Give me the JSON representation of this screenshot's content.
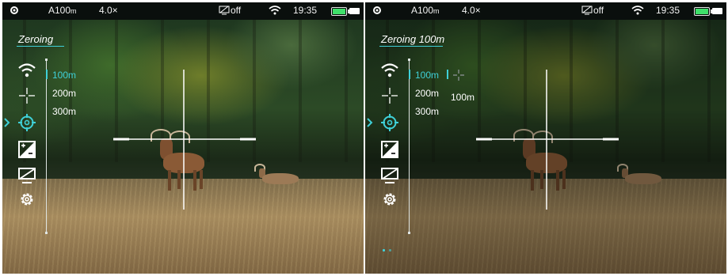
{
  "colors": {
    "accent": "#3fd0d8",
    "battery": "#3fe06a",
    "statusbar_bg": "#0a0f0d"
  },
  "screens": [
    {
      "status": {
        "profile": "A100",
        "profile_unit": "m",
        "zoom": "4.0×",
        "display_mode": "off",
        "time": "19:35"
      },
      "menu_title": "Zeroing",
      "menu_icons": [
        "wifi-icon",
        "crosshair-icon",
        "zeroing-target-icon",
        "brightness-icon",
        "display-off-icon",
        "settings-gear-icon"
      ],
      "selected_menu": "zeroing-target-icon",
      "options": [
        "100m",
        "200m",
        "300m"
      ],
      "selected_option": "100m"
    },
    {
      "status": {
        "profile": "A100",
        "profile_unit": "m",
        "zoom": "4.0×",
        "display_mode": "off",
        "time": "19:35"
      },
      "menu_title": "Zeroing 100m",
      "menu_icons": [
        "wifi-icon",
        "crosshair-icon",
        "zeroing-target-icon",
        "brightness-icon",
        "display-off-icon",
        "settings-gear-icon"
      ],
      "selected_menu": "zeroing-target-icon",
      "options": [
        "100m",
        "200m",
        "300m"
      ],
      "selected_option": "100m",
      "submenu_label": "100m"
    }
  ]
}
